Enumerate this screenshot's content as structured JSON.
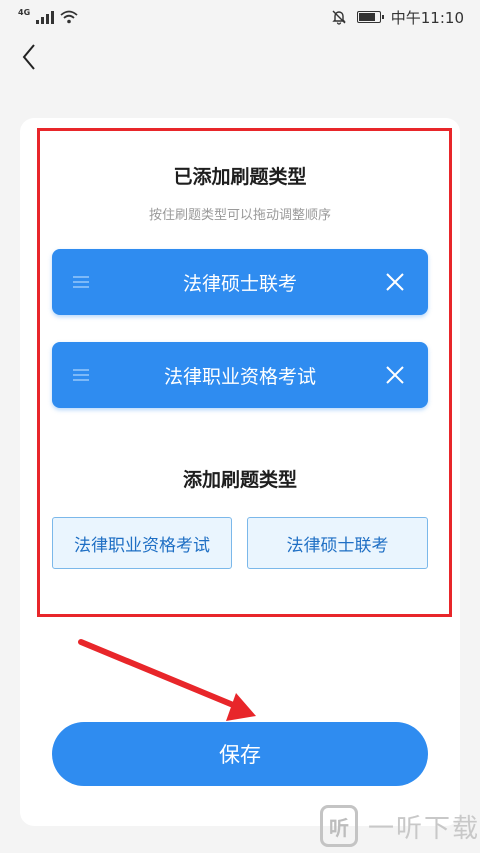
{
  "status_bar": {
    "network": "4G",
    "time": "中午11:10"
  },
  "icons": {
    "back": "chevron-left-icon",
    "drag": "drag-handle-icon",
    "remove": "close-icon"
  },
  "added_section": {
    "title": "已添加刷题类型",
    "hint": "按住刷题类型可以拖动调整顺序",
    "items": [
      {
        "label": "法律硕士联考"
      },
      {
        "label": "法律职业资格考试"
      }
    ]
  },
  "add_section": {
    "title": "添加刷题类型",
    "options": [
      {
        "label": "法律职业资格考试"
      },
      {
        "label": "法律硕士联考"
      }
    ]
  },
  "save_label": "保存",
  "watermark": {
    "logo": "听",
    "text": "一听下载"
  },
  "colors": {
    "primary": "#2f8cf0",
    "annotation": "#e8262a",
    "option_border": "#7bb8ea",
    "option_bg": "#eaf5fe"
  }
}
